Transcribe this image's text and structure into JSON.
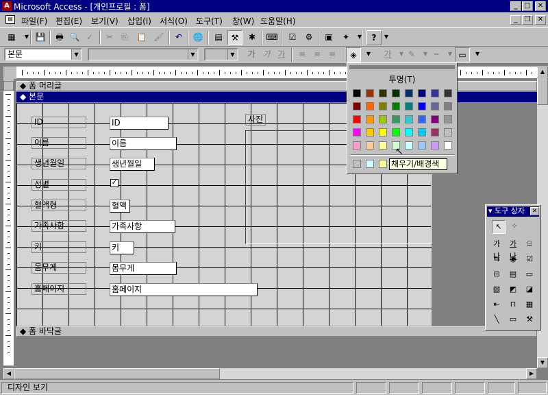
{
  "window": {
    "title": "Microsoft Access - [개인프로필 : 폼]"
  },
  "menu": {
    "items": [
      "파일(F)",
      "편집(E)",
      "보기(V)",
      "삽입(I)",
      "서식(O)",
      "도구(T)",
      "창(W)",
      "도움말(H)"
    ]
  },
  "format_toolbar": {
    "object_combo": "본문",
    "font_combo": "",
    "size_combo": "",
    "bold": "가",
    "italic": "가",
    "underline": "가",
    "font_color": "가"
  },
  "sections": {
    "header": "폼 머리글",
    "detail": "본문",
    "footer": "폼 바닥글"
  },
  "fields": [
    {
      "label": "ID",
      "value": "ID"
    },
    {
      "label": "이름",
      "value": "이름"
    },
    {
      "label": "생년월일",
      "value": "생년월일"
    },
    {
      "label": "성별",
      "value": "✓"
    },
    {
      "label": "혈액형",
      "value": "혈액"
    },
    {
      "label": "가족사항",
      "value": "가족사항"
    },
    {
      "label": "키",
      "value": "키"
    },
    {
      "label": "몸무게",
      "value": "몸무게"
    },
    {
      "label": "홈페이지",
      "value": "홈페이지"
    }
  ],
  "photo": {
    "label": "사진"
  },
  "palette": {
    "transparent_label": "투명(T)",
    "tooltip": "채우기/배경색",
    "colors": [
      [
        "#000000",
        "#993300",
        "#333300",
        "#003300",
        "#003366",
        "#000080",
        "#333399",
        "#333333"
      ],
      [
        "#800000",
        "#FF6600",
        "#808000",
        "#008000",
        "#008080",
        "#0000FF",
        "#666699",
        "#808080"
      ],
      [
        "#FF0000",
        "#FF9900",
        "#99CC00",
        "#339966",
        "#33CCCC",
        "#3366FF",
        "#800080",
        "#969696"
      ],
      [
        "#FF00FF",
        "#FFCC00",
        "#FFFF00",
        "#00FF00",
        "#00FFFF",
        "#00CCFF",
        "#993366",
        "#C0C0C0"
      ],
      [
        "#FF99CC",
        "#FFCC99",
        "#FFFF99",
        "#CCFFCC",
        "#CCFFFF",
        "#99CCFF",
        "#CC99FF",
        "#FFFFFF"
      ]
    ],
    "recent": [
      "#C0C0C0",
      "#CCFFFF",
      "#FFFF99"
    ]
  },
  "toolbox": {
    "title": "도구 상자",
    "label_tool": "가나",
    "text_tool": "가나"
  },
  "status": {
    "text": "디자인 보기"
  }
}
